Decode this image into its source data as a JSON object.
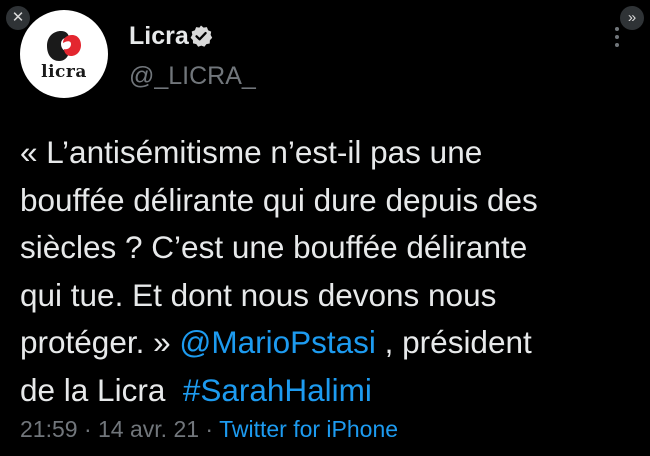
{
  "viewer": {
    "close_glyph": "✕",
    "expand_glyph": "»"
  },
  "author": {
    "avatar_text": "licra",
    "display_name": "Licra",
    "handle": "@_LICRA_",
    "verified": true,
    "verified_icon": "verified-badge-icon",
    "logo_colors": [
      "#1a1a1a",
      "#e3262f"
    ]
  },
  "tweet": {
    "lines": {
      "l1": "« L’antisémitisme n’est-il pas une",
      "l2": "bouffée délirante qui dure depuis des",
      "l3": "siècles ? C’est une bouffée délirante",
      "l4": "qui tue. Et dont nous devons nous",
      "l5_before": "protéger. » ",
      "mention": "@MarioPstasi",
      "l5_after": " , président",
      "l6_before": "de la Licra  ",
      "hashtag": "#SarahHalimi"
    },
    "time": "21:59",
    "separator": " · ",
    "date": "14 avr. 21",
    "source": "Twitter for iPhone"
  },
  "colors": {
    "background": "#000000",
    "text": "#e7e9ea",
    "secondary": "#71767b",
    "link": "#1d9bf0"
  }
}
